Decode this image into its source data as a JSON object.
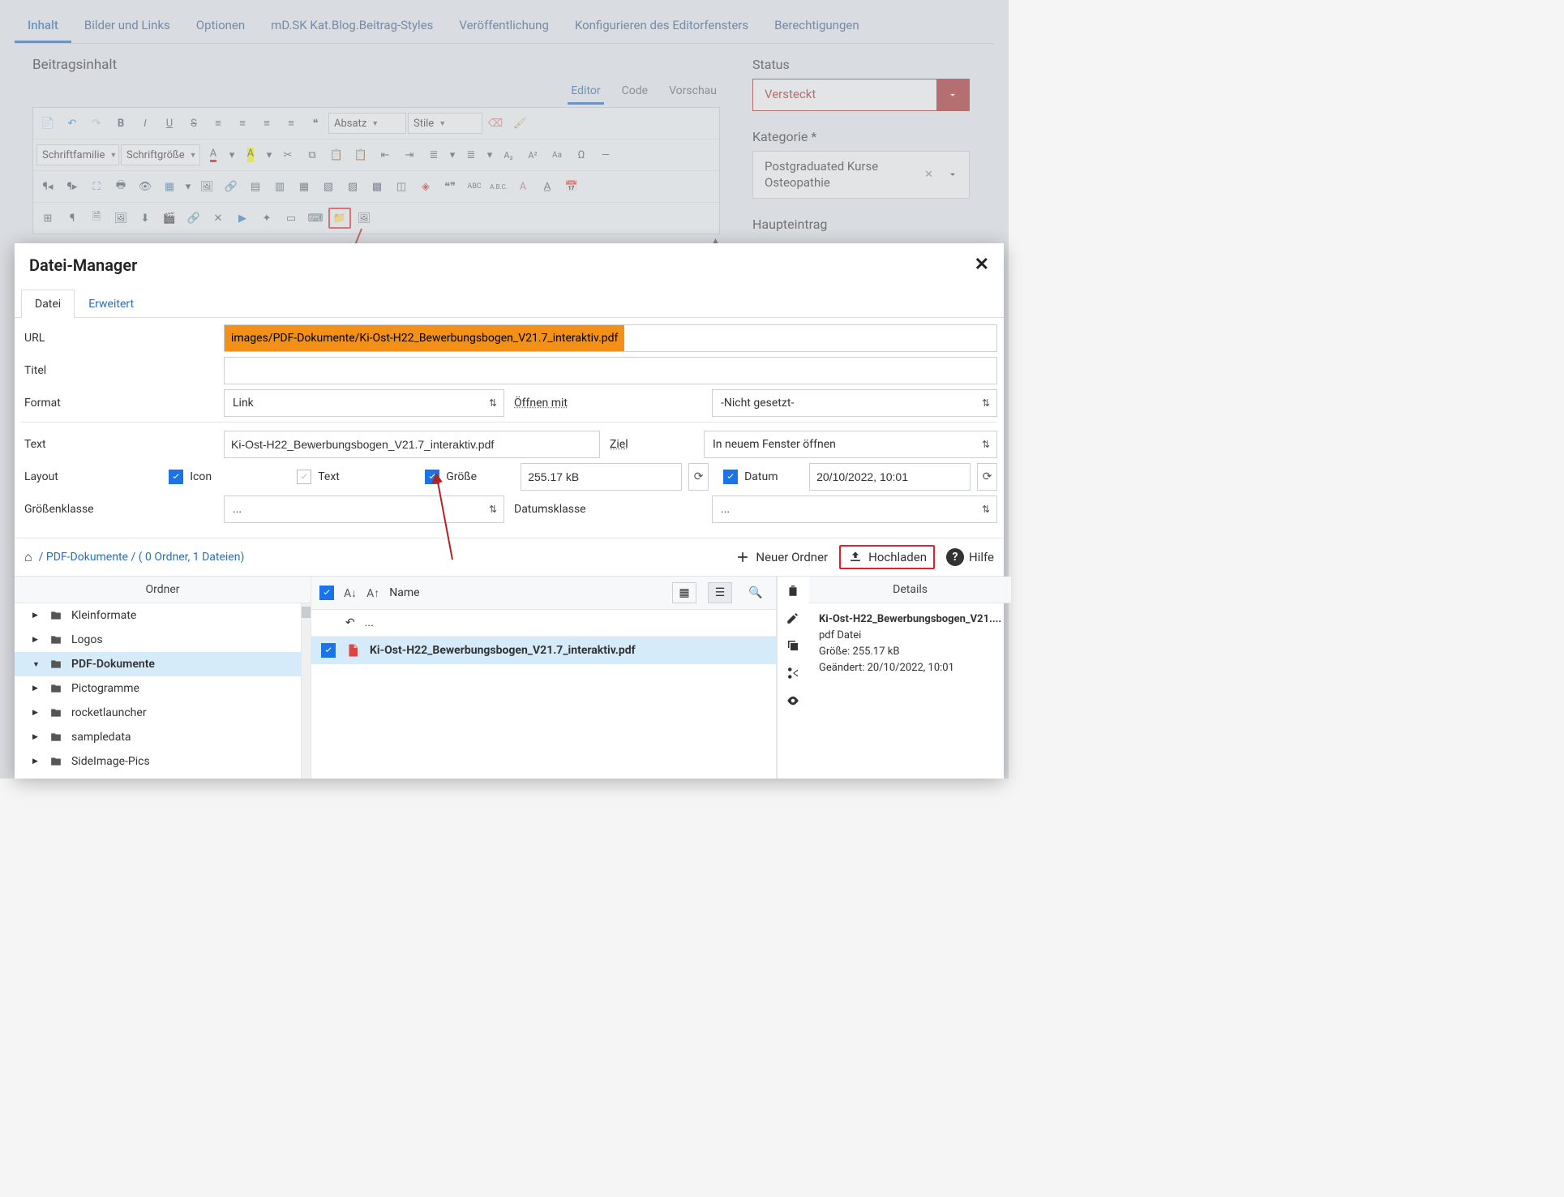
{
  "tabs": {
    "inhalt": "Inhalt",
    "bilderlinks": "Bilder und Links",
    "optionen": "Optionen",
    "mdsk": "mD.SK Kat.Blog.Beitrag-Styles",
    "veroeff": "Veröffentlichung",
    "konfig": "Konfigurieren des Editorfensters",
    "berecht": "Berechtigungen"
  },
  "content_title": "Beitragsinhalt",
  "editor_tabs": {
    "editor": "Editor",
    "code": "Code",
    "vorschau": "Vorschau"
  },
  "toolbar": {
    "absatz": "Absatz",
    "stile": "Stile",
    "fontfamily": "Schriftfamilie",
    "fontsize": "Schriftgröße",
    "abc": "ABC",
    "abc2": "A.B.C."
  },
  "sidebar": {
    "status_label": "Status",
    "status_value": "Versteckt",
    "kategorie_label": "Kategorie *",
    "kategorie_value": "Postgraduated Kurse Osteopathie",
    "haupteintrag": "Haupteintrag"
  },
  "modal": {
    "title": "Datei-Manager",
    "tabs": {
      "datei": "Datei",
      "erweitert": "Erweitert"
    },
    "labels": {
      "url": "URL",
      "titel": "Titel",
      "format": "Format",
      "oeffnen": "Öffnen mit",
      "text": "Text",
      "ziel": "Ziel",
      "layout": "Layout",
      "groessenklasse": "Größenklasse",
      "datumsklasse": "Datumsklasse",
      "icon": "Icon",
      "text_chk": "Text",
      "groesse": "Größe",
      "datum": "Datum"
    },
    "values": {
      "url": "images/PDF-Dokumente/Ki-Ost-H22_Bewerbungsbogen_V21.7_interaktiv.pdf",
      "format": "Link",
      "oeffnen": "-Nicht gesetzt-",
      "text": "Ki-Ost-H22_Bewerbungsbogen_V21.7_interaktiv.pdf",
      "ziel": "In neuem Fenster öffnen",
      "groesse": "255.17 kB",
      "datum": "20/10/2022, 10:01",
      "groessenklasse": "...",
      "datumsklasse": "..."
    }
  },
  "browser": {
    "crumb_folder": "PDF-Dokumente",
    "crumb_info": "( 0 Ordner, 1 Dateien)",
    "neuer_ordner": "Neuer Ordner",
    "hochladen": "Hochladen",
    "hilfe": "Hilfe",
    "col_ordner": "Ordner",
    "col_name": "Name",
    "col_details": "Details",
    "up_dots": "...",
    "folders": {
      "kleinformate": "Kleinformate",
      "logos": "Logos",
      "pdf": "PDF-Dokumente",
      "pictogramme": "Pictogramme",
      "rocketlauncher": "rocketlauncher",
      "sampledata": "sampledata",
      "sideimage": "SideImage-Pics"
    },
    "file_name": "Ki-Ost-H22_Bewerbungsbogen_V21.7_interaktiv.pdf",
    "details": {
      "name": "Ki-Ost-H22_Bewerbungsbogen_V21....",
      "type": "pdf Datei",
      "size": "Größe: 255.17 kB",
      "modified": "Geändert: 20/10/2022, 10:01"
    }
  }
}
